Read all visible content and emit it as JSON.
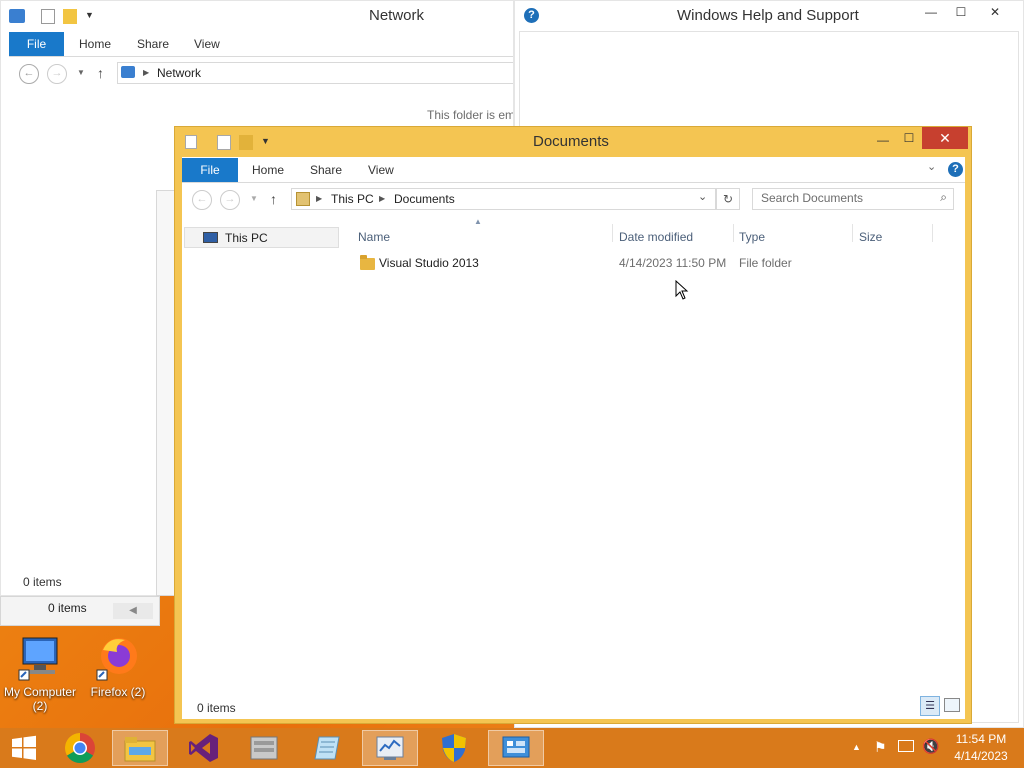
{
  "network_window": {
    "title": "Network",
    "ribbon_tabs": [
      "File",
      "Home",
      "Share",
      "View"
    ],
    "address": "Network",
    "empty_message": "This folder is em",
    "status": "0 items"
  },
  "help_window": {
    "title": "Windows Help and Support"
  },
  "behind_window": {
    "status": "0 items"
  },
  "documents_window": {
    "title": "Documents",
    "ribbon_tabs": [
      "File",
      "Home",
      "Share",
      "View"
    ],
    "breadcrumb": [
      "This PC",
      "Documents"
    ],
    "search_placeholder": "Search Documents",
    "nav_pane": [
      "This PC"
    ],
    "columns": [
      "Name",
      "Date modified",
      "Type",
      "Size"
    ],
    "rows": [
      {
        "name": "Visual Studio 2013",
        "date": "4/14/2023 11:50 PM",
        "type": "File folder",
        "size": ""
      }
    ],
    "status": "0 items"
  },
  "desktop_icons": [
    {
      "label": "My Computer (2)",
      "icon": "computer-icon"
    },
    {
      "label": "Firefox (2)",
      "icon": "firefox-icon"
    }
  ],
  "taskbar": {
    "items": [
      "start",
      "chrome",
      "file-explorer",
      "visual-studio",
      "server-manager",
      "notepad",
      "performance-monitor",
      "security",
      "control-panel"
    ],
    "clock_time": "11:54 PM",
    "clock_date": "4/14/2023"
  },
  "colors": {
    "accent": "#1979ca",
    "window_frame": "#f0c95c",
    "desktop": "#e8821a",
    "close": "#c7402f"
  }
}
